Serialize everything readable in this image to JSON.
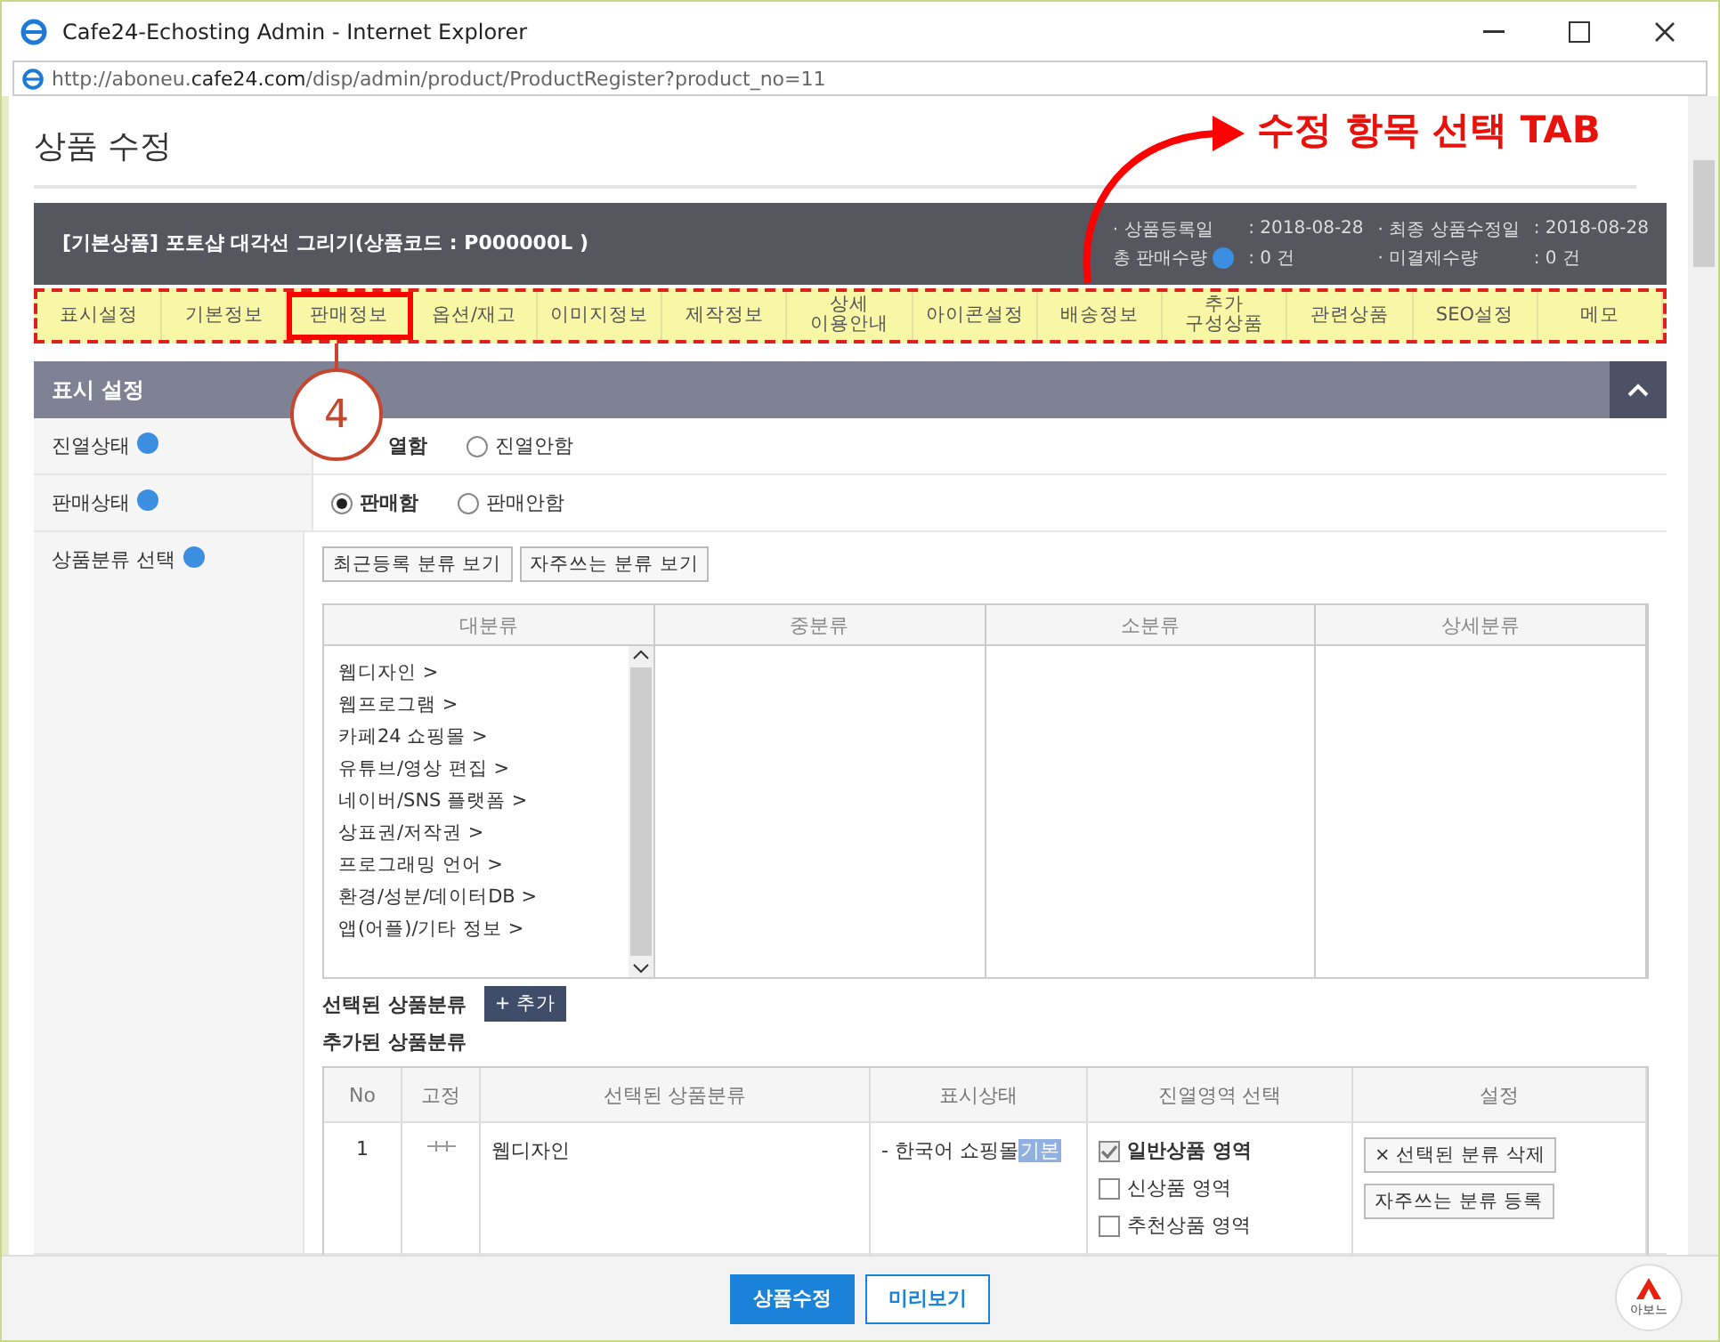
{
  "window": {
    "title": "Cafe24-Echosting Admin - Internet Explorer",
    "url_prefix": "http://aboneu.",
    "url_domain": "cafe24.com",
    "url_path": "/disp/admin/product/ProductRegister?product_no=11"
  },
  "page_title": "상품 수정",
  "annotation": {
    "text": "수정 항목 선택 TAB",
    "step": "4"
  },
  "product_header": {
    "title": "[기본상품] 포토샵 대각선 그리기(상품코드 : P000000L )",
    "stats": [
      {
        "label": "· 상품등록일",
        "value": ": 2018-08-28",
        "help": false
      },
      {
        "label": "· 최종 상품수정일",
        "value": ": 2018-08-28",
        "help": false
      },
      {
        "label": "총 판매수량",
        "value": ": 0 건",
        "help": true
      },
      {
        "label": "· 미결제수량",
        "value": ": 0 건",
        "help": false
      }
    ]
  },
  "tabs": [
    {
      "label": "표시설정",
      "highlighted": false
    },
    {
      "label": "기본정보",
      "highlighted": false
    },
    {
      "label": "판매정보",
      "highlighted": true
    },
    {
      "label": "옵션/재고",
      "highlighted": false
    },
    {
      "label": "이미지정보",
      "highlighted": false
    },
    {
      "label": "제작정보",
      "highlighted": false
    },
    {
      "label": "상세\n이용안내",
      "highlighted": false
    },
    {
      "label": "아이콘설정",
      "highlighted": false
    },
    {
      "label": "배송정보",
      "highlighted": false
    },
    {
      "label": "추가\n구성상품",
      "highlighted": false
    },
    {
      "label": "관련상품",
      "highlighted": false
    },
    {
      "label": "SEO설정",
      "highlighted": false
    },
    {
      "label": "메모",
      "highlighted": false
    }
  ],
  "section": {
    "title": "표시 설정",
    "expanded": true,
    "radio_rows": [
      {
        "label": "진열상태",
        "options": [
          {
            "label": "열함",
            "selected": true,
            "radio_hidden": true
          },
          {
            "label": "진열안함",
            "selected": false
          }
        ]
      },
      {
        "label": "판매상태",
        "options": [
          {
            "label": "판매함",
            "selected": true
          },
          {
            "label": "판매안함",
            "selected": false
          }
        ]
      }
    ],
    "category": {
      "label": "상품분류 선택",
      "buttons": [
        "최근등록 분류 보기",
        "자주쓰는 분류 보기"
      ],
      "columns": [
        "대분류",
        "중분류",
        "소분류",
        "상세분류"
      ],
      "items": [
        "웹디자인 >",
        "웹프로그램 >",
        "카페24 쇼핑몰 >",
        "유튜브/영상 편집 >",
        "네이버/SNS 플랫폼 >",
        "상표권/저작권 >",
        "프로그래밍 언어 >",
        "환경/성분/데이터DB >",
        "앱(어플)/기타 정보 >"
      ],
      "selected_label": "선택된 상품분류",
      "add_button": "+ 추가",
      "added_label": "추가된 상품분류",
      "table": {
        "columns": [
          "No",
          "고정",
          "선택된 상품분류",
          "표시상태",
          "진열영역 선택",
          "설정"
        ],
        "rows": [
          {
            "no": "1",
            "name": "웹디자인",
            "status": "- 한국어 쇼핑몰",
            "status_tag": "기본",
            "areas": [
              {
                "label": "일반상품 영역",
                "checked": true
              },
              {
                "label": "신상품 영역",
                "checked": false
              },
              {
                "label": "추천상품 영역",
                "checked": false
              }
            ],
            "actions": [
              "× 선택된 분류 삭제",
              "자주쓰는 분류 등록"
            ]
          }
        ]
      }
    }
  },
  "footer": {
    "buttons": [
      {
        "label": "상품수정",
        "kind": "primary"
      },
      {
        "label": "미리보기",
        "kind": "secondary"
      }
    ],
    "badge": "아보느"
  }
}
